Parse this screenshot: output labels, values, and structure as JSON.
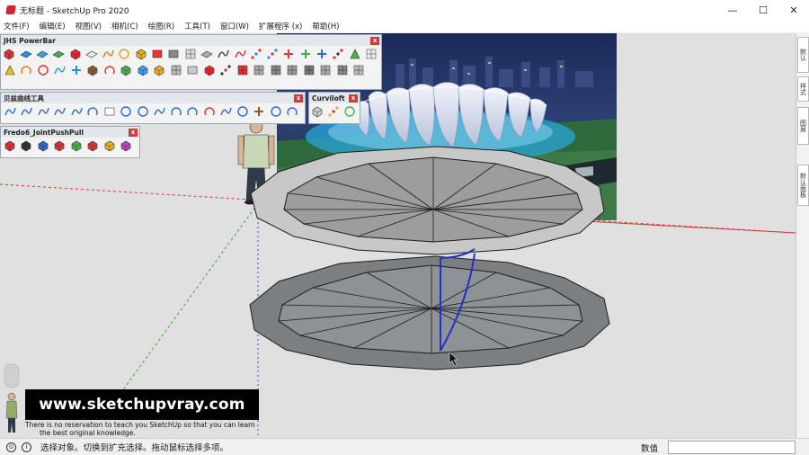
{
  "window": {
    "title": "无标题 - SketchUp Pro 2020",
    "minimize": "—",
    "maximize": "☐",
    "close": "✕"
  },
  "menu": [
    "文件(F)",
    "编辑(E)",
    "视图(V)",
    "相机(C)",
    "绘图(R)",
    "工具(T)",
    "窗口(W)",
    "扩展程序 (x)",
    "帮助(H)"
  ],
  "toolbars": {
    "powerbar": {
      "title": "JHS PowerBar",
      "close": "x"
    },
    "bezier": {
      "title": "贝兹曲线工具",
      "close": "x"
    },
    "curviloft": {
      "title": "Curviloft",
      "close": "x"
    },
    "fredo": {
      "title": "Fredo6_JointPushPull",
      "close": "x"
    }
  },
  "tray_tabs": [
    "默认",
    "样式",
    "图层",
    "默认面板"
  ],
  "watermark": {
    "url": "www.sketchupvray.com",
    "line1": "There is no reservation to teach you SketchUp so that you can learn",
    "line2": "the best original knowledge."
  },
  "status": {
    "hint": "选择对象。切换到扩充选择。拖动鼠标选择多项。",
    "vcb_label": "数值",
    "vcb_value": ""
  },
  "colors": {
    "viewport_bg": "#dfe0df",
    "red_axis": "#d23a3a",
    "green_axis": "#3fa43f",
    "blue_edge": "#1f2fd0"
  }
}
